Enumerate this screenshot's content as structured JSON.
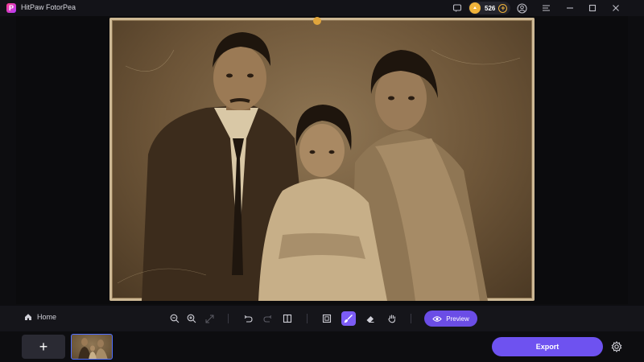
{
  "app": {
    "title": "HitPaw FotorPea",
    "logo_letter": "P"
  },
  "titlebar": {
    "credits": "526",
    "icons": [
      "feedback-icon",
      "coin-icon",
      "add-credits-icon",
      "account-icon",
      "menu-icon",
      "minimize-icon",
      "maximize-icon",
      "close-icon"
    ]
  },
  "toolbar": {
    "home_label": "Home",
    "preview_label": "Preview",
    "tools": [
      "zoom-out-icon",
      "zoom-in-icon",
      "fit-screen-icon",
      "undo-icon",
      "redo-icon",
      "compare-icon",
      "crop-frame-icon",
      "brush-icon",
      "eraser-icon",
      "hand-icon"
    ],
    "active_tool": "brush-icon"
  },
  "bottom": {
    "add_label": "+",
    "export_label": "Export"
  },
  "colors": {
    "accent": "#6e52f0",
    "coin": "#f0b33a",
    "background": "#0d0d10"
  }
}
